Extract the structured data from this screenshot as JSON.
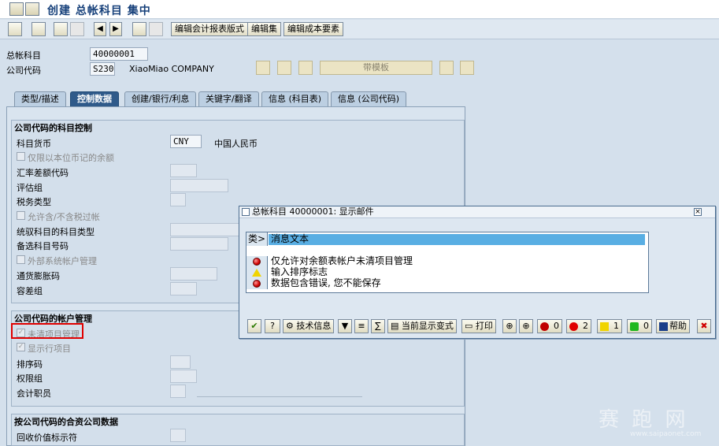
{
  "window": {
    "title": "创建 总帐科目 集中"
  },
  "toolbar": {
    "buttons": [
      "编辑会计报表版式",
      "编辑集",
      "编辑成本要素"
    ]
  },
  "header": {
    "gl_account_label": "总帐科目",
    "gl_account_value": "40000001",
    "company_code_label": "公司代码",
    "company_code_value": "S230",
    "company_name": "XiaoMiao COMPANY",
    "template_button": "带模板"
  },
  "tabs": [
    {
      "label": "类型/描述"
    },
    {
      "label": "控制数据",
      "active": true
    },
    {
      "label": "创建/银行/利息"
    },
    {
      "label": "关键字/翻译"
    },
    {
      "label": "信息 (科目表)"
    },
    {
      "label": "信息 (公司代码)"
    }
  ],
  "group_control": {
    "title": "公司代码的科目控制",
    "currency_label": "科目货币",
    "currency_value": "CNY",
    "currency_name": "中国人民币",
    "only_local_currency": "仅限以本位币记的余额",
    "fx_diff_key": "汇率差额代码",
    "valuation_group": "评估组",
    "tax_category": "税务类型",
    "posting_without_tax": "允许含/不含税过帐",
    "recon_account_type": "统驭科目的科目类型",
    "alt_account": "备选科目号码",
    "external_mgmt": "外部系统帐户管理",
    "inflation_key": "通货膨胀码",
    "tolerance_group": "容差组"
  },
  "group_account_mgmt": {
    "title": "公司代码的帐户管理",
    "open_item_mgmt": "未清项目管理",
    "line_item_display": "显示行项目",
    "sort_key": "排序码",
    "auth_group": "权限组",
    "accounting_clerk": "会计职员"
  },
  "group_jv": {
    "title": "按公司代码的合资公司数据",
    "recovery_indicator": "回收价值标示符"
  },
  "dialog": {
    "title": "总帐科目 40000001: 显示邮件",
    "col_type": "类",
    "col_text": "消息文本",
    "messages": [
      {
        "type": "error",
        "text": "仅允许对余额表帐户未清项目管理"
      },
      {
        "type": "warning",
        "text": "输入排序标志"
      },
      {
        "type": "error",
        "text": "数据包含错误, 您不能保存"
      }
    ],
    "tech_info": "技术信息",
    "current_variant": "当前显示变式",
    "print": "打印",
    "count_stop": "0",
    "count_error": "2",
    "count_warning": "1",
    "count_success": "0",
    "help": "帮助"
  },
  "watermark": {
    "text": "赛 跑 网",
    "url": "www.saipaonet.com"
  }
}
